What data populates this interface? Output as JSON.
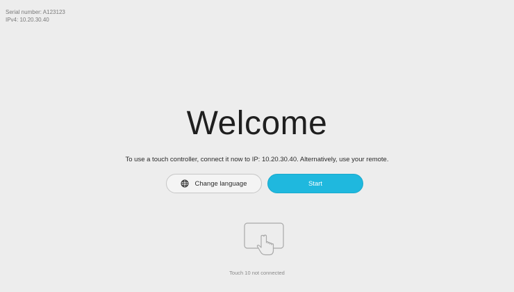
{
  "device_info": {
    "serial_number": "Serial number: A123123",
    "ipv4": "IPv4: 10.20.30.40"
  },
  "welcome": {
    "title": "Welcome",
    "instructions": "To use a touch controller, connect it now to IP: 10.20.30.40. Alternatively, use your remote."
  },
  "actions": {
    "change_language_label": "Change language",
    "change_language_icon": "globe-icon",
    "start_label": "Start"
  },
  "touch_controller": {
    "icon": "touch-panel-icon",
    "status": "Touch 10 not connected"
  },
  "colors": {
    "background": "#ededed",
    "accent": "#1fb8de"
  }
}
